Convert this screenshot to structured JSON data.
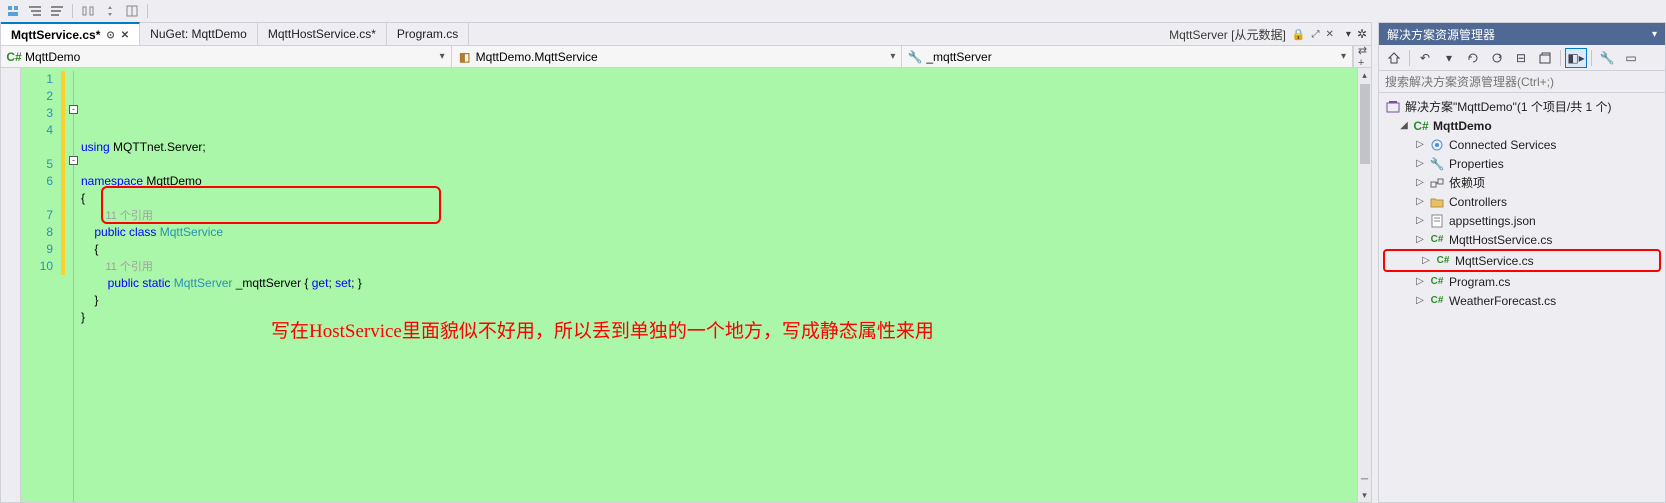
{
  "top_icons": [
    "tool-a",
    "tool-b",
    "tool-c",
    "tool-d",
    "tool-e",
    "tool-f"
  ],
  "tabs": [
    {
      "label": "MqttService.cs*",
      "active": true,
      "pin": true,
      "close": true
    },
    {
      "label": "NuGet: MqttDemo",
      "active": false
    },
    {
      "label": "MqttHostService.cs*",
      "active": false
    },
    {
      "label": "Program.cs",
      "active": false
    }
  ],
  "tab_right": {
    "label": "MqttServer [从元数据]",
    "locked": true
  },
  "dropdowns": {
    "project": "MqttDemo",
    "class": "MqttDemo.MqttService",
    "member": "_mqttServer"
  },
  "code": {
    "line_count": 10,
    "lines": [
      {
        "n": 1,
        "text": "using MQTTnet.Server;",
        "tokens": [
          {
            "t": "using ",
            "c": "kw"
          },
          {
            "t": "MQTTnet.Server;",
            "c": ""
          }
        ]
      },
      {
        "n": 2,
        "text": "",
        "tokens": []
      },
      {
        "n": 3,
        "text": "namespace MqttDemo",
        "tokens": [
          {
            "t": "namespace ",
            "c": "kw"
          },
          {
            "t": "MqttDemo",
            "c": ""
          }
        ]
      },
      {
        "n": 4,
        "text": "{",
        "tokens": [
          {
            "t": "{",
            "c": ""
          }
        ]
      },
      {
        "n": 4,
        "sub": true,
        "codelens": "11 个引用"
      },
      {
        "n": 5,
        "text": "    public class MqttService",
        "tokens": [
          {
            "t": "    ",
            "c": ""
          },
          {
            "t": "public class ",
            "c": "kw"
          },
          {
            "t": "MqttService",
            "c": "type"
          }
        ]
      },
      {
        "n": 6,
        "text": "    {",
        "tokens": [
          {
            "t": "    {",
            "c": ""
          }
        ]
      },
      {
        "n": 6,
        "sub": true,
        "codelens": "11 个引用"
      },
      {
        "n": 7,
        "text": "        public static MqttServer _mqttServer { get; set; }",
        "tokens": [
          {
            "t": "        ",
            "c": ""
          },
          {
            "t": "public static ",
            "c": "kw"
          },
          {
            "t": "MqttServer ",
            "c": "type"
          },
          {
            "t": "_mqttServer { ",
            "c": ""
          },
          {
            "t": "get",
            "c": "kw"
          },
          {
            "t": "; ",
            "c": ""
          },
          {
            "t": "set",
            "c": "kw"
          },
          {
            "t": "; }",
            "c": ""
          }
        ]
      },
      {
        "n": 8,
        "text": "    }",
        "tokens": [
          {
            "t": "    }",
            "c": ""
          }
        ]
      },
      {
        "n": 9,
        "text": "}",
        "tokens": [
          {
            "t": "}",
            "c": ""
          }
        ]
      },
      {
        "n": 10,
        "text": "",
        "tokens": []
      }
    ],
    "annotation": "写在HostService里面貌似不好用，所以丢到单独的一个地方，写成静态属性来用"
  },
  "sidebar": {
    "title": "解决方案资源管理器",
    "search_placeholder": "搜索解决方案资源管理器(Ctrl+;)",
    "solution_label": "解决方案\"MqttDemo\"(1 个项目/共 1 个)",
    "project": "MqttDemo",
    "nodes": [
      {
        "label": "Connected Services",
        "icon": "connected",
        "depth": 2,
        "exp": "▷"
      },
      {
        "label": "Properties",
        "icon": "wrench",
        "depth": 2,
        "exp": "▷"
      },
      {
        "label": "依赖项",
        "icon": "deps",
        "depth": 2,
        "exp": "▷"
      },
      {
        "label": "Controllers",
        "icon": "folder",
        "depth": 2,
        "exp": "▷"
      },
      {
        "label": "appsettings.json",
        "icon": "json",
        "depth": 2,
        "exp": "▷"
      },
      {
        "label": "MqttHostService.cs",
        "icon": "cs",
        "depth": 2,
        "exp": "▷"
      },
      {
        "label": "MqttService.cs",
        "icon": "cs",
        "depth": 2,
        "exp": "▷",
        "highlight": true
      },
      {
        "label": "Program.cs",
        "icon": "cs",
        "depth": 2,
        "exp": "▷"
      },
      {
        "label": "WeatherForecast.cs",
        "icon": "cs",
        "depth": 2,
        "exp": "▷"
      }
    ]
  }
}
